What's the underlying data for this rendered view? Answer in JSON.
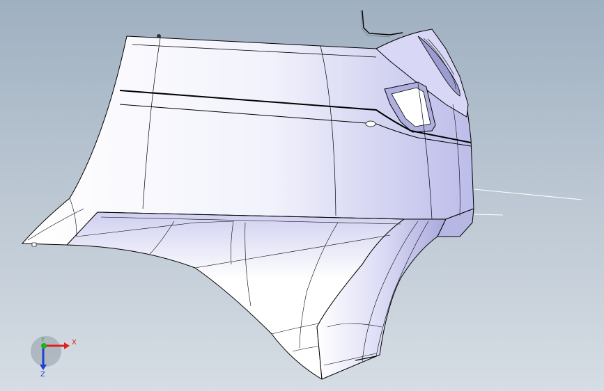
{
  "viewport": {
    "background_top": "#9fb0c1",
    "background_bottom": "#d6dde4",
    "model_face_color": "#ffffff",
    "model_shade_color": "#d2d2f4",
    "edge_color": "#000000"
  },
  "triad": {
    "x_label": "X",
    "y_label": "Y",
    "z_label": "Z",
    "x_color": "#e02020",
    "y_color": "#20b020",
    "z_color": "#2040d0"
  }
}
